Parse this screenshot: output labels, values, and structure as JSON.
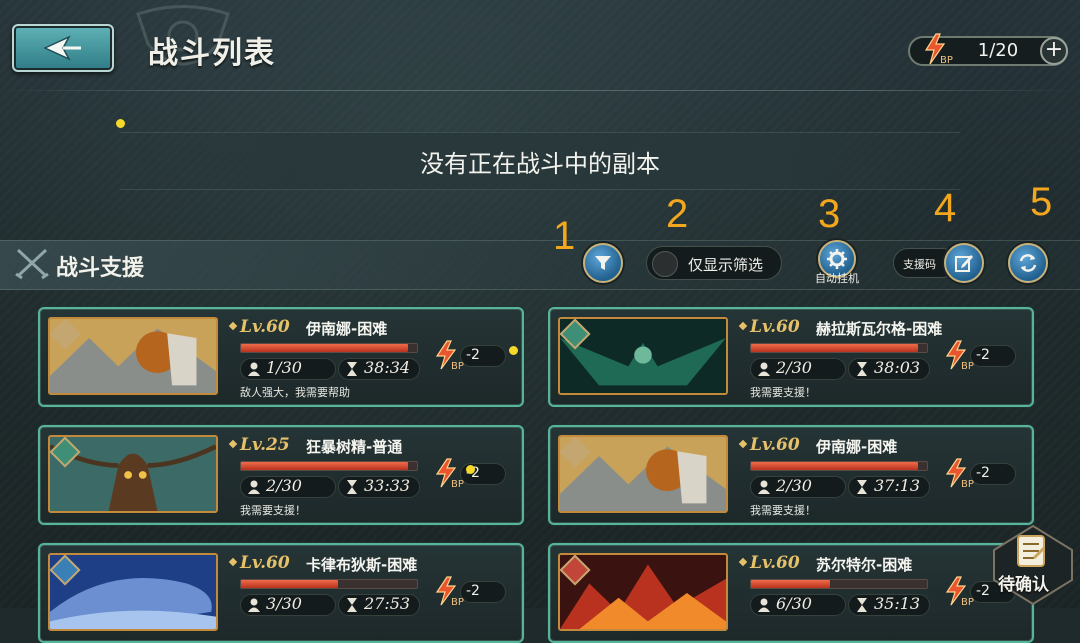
{
  "header": {
    "title": "战斗列表",
    "bp": {
      "label": "BP",
      "value": "1/20",
      "plus": "+"
    }
  },
  "empty_message": "没有正在战斗中的副本",
  "section": {
    "title": "战斗支援",
    "toggle_label": "仅显示筛选",
    "auto_label": "自动挂机",
    "support_code_label": "支援码"
  },
  "markers": [
    "1",
    "2",
    "3",
    "4",
    "5"
  ],
  "cards": [
    {
      "level": "Lv.60",
      "name": "伊南娜-困难",
      "hp": 0.95,
      "players": "1/30",
      "time": "38:34",
      "bp_label": "BP",
      "cost": "-2",
      "message": "敌人强大，我需要帮助",
      "element_color": "#c4a770",
      "scene": "inanna"
    },
    {
      "level": "Lv.60",
      "name": "赫拉斯瓦尔格-困难",
      "hp": 0.95,
      "players": "2/30",
      "time": "38:03",
      "bp_label": "BP",
      "cost": "-2",
      "message": "我需要支援！",
      "element_color": "#3f8f77",
      "scene": "bird"
    },
    {
      "level": "Lv.25",
      "name": "狂暴树精-普通",
      "hp": 0.95,
      "players": "2/30",
      "time": "33:33",
      "bp_label": "BP",
      "cost": "-2",
      "message": "我需要支援！",
      "element_color": "#3f8f77",
      "scene": "tree"
    },
    {
      "level": "Lv.60",
      "name": "伊南娜-困难",
      "hp": 0.95,
      "players": "2/30",
      "time": "37:13",
      "bp_label": "BP",
      "cost": "-2",
      "message": "我需要支援！",
      "element_color": "#c4a770",
      "scene": "inanna"
    },
    {
      "level": "Lv.60",
      "name": "卡律布狄斯-困难",
      "hp": 0.55,
      "players": "3/30",
      "time": "27:53",
      "bp_label": "BP",
      "cost": "-2",
      "message": "",
      "element_color": "#3a7fb5",
      "scene": "whale"
    },
    {
      "level": "Lv.60",
      "name": "苏尔特尔-困难",
      "hp": 0.45,
      "players": "6/30",
      "time": "35:13",
      "bp_label": "BP",
      "cost": "-2",
      "message": "",
      "element_color": "#c2453a",
      "scene": "fire"
    }
  ],
  "pending": {
    "label": "待确认"
  }
}
